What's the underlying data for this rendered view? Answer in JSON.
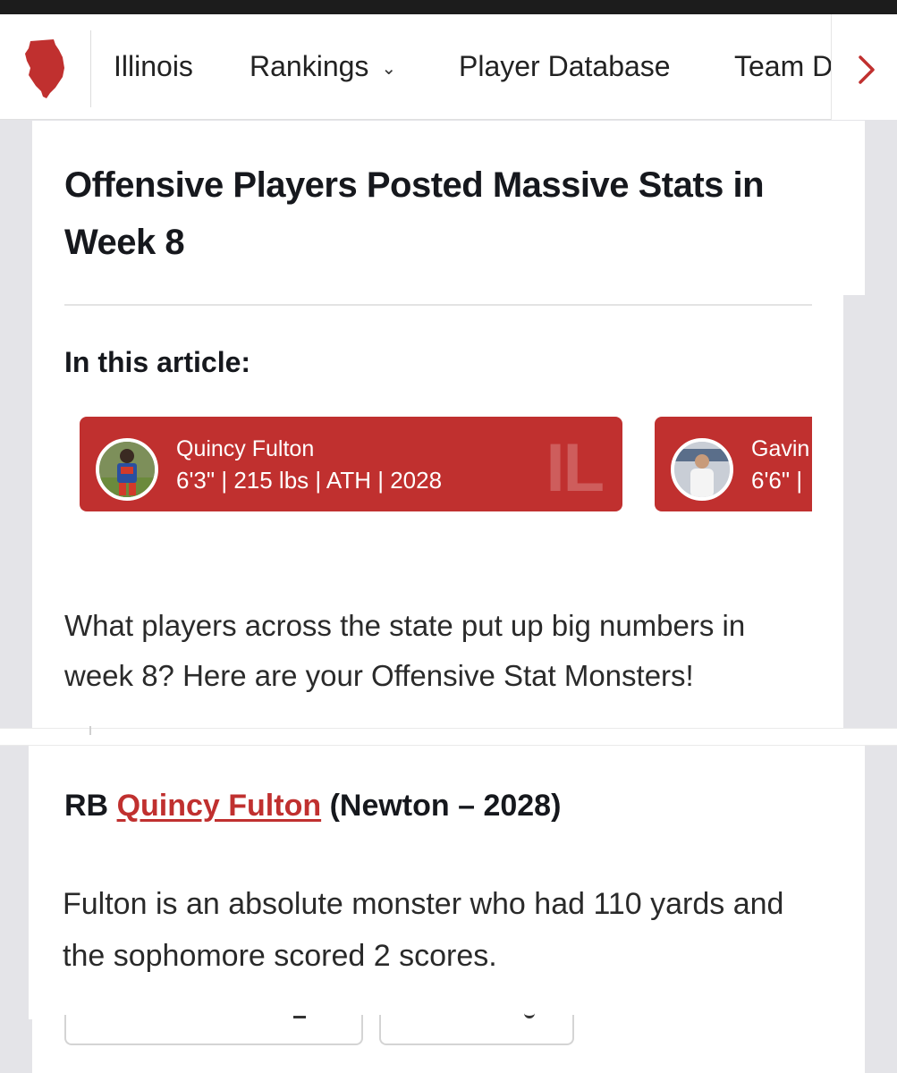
{
  "colors": {
    "brand_red": "#c0302f",
    "text_dark": "#16181d"
  },
  "nav": {
    "logo_icon": "illinois-state-shape-icon",
    "items": [
      {
        "label": "Illinois"
      },
      {
        "label": "Rankings",
        "has_dropdown": true
      },
      {
        "label": "Player Database"
      },
      {
        "label": "Team D"
      }
    ],
    "more_icon": "chevron-right-icon",
    "dropdown_glyph": "⌄",
    "more_glyph": "›"
  },
  "article": {
    "title": "Offensive Players Posted Massive Stats in Week 8",
    "in_this_article": "In this article:",
    "players": [
      {
        "name": "Quincy Fulton",
        "meta": "6'3\" | 215 lbs | ATH | 2028",
        "state": "IL"
      },
      {
        "name": "Gavin",
        "meta": "6'6\" |"
      }
    ],
    "intro": "What players across the state put up big numbers in week 8?  Here are your Offensive Stat Monsters!",
    "sections": [
      {
        "position": "RB",
        "player_link": "Quincy Fulton",
        "school_year": "(Newton – 2028)",
        "body": "Fulton is an absolute monster who had 110 yards and the sophomore scored 2 scores."
      }
    ]
  }
}
